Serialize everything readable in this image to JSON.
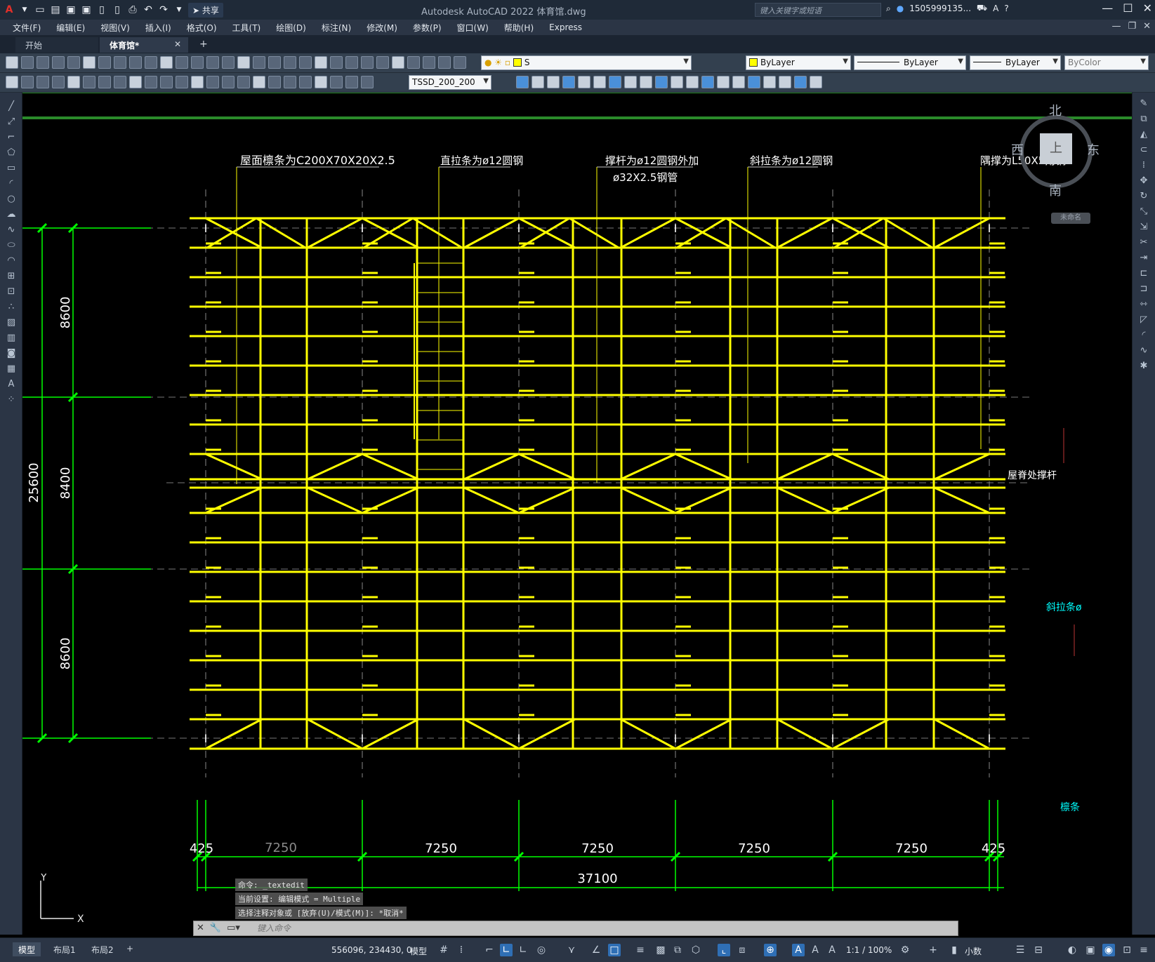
{
  "title_bar": {
    "share_label": "共享",
    "app_title": "Autodesk AutoCAD 2022    体育馆.dwg",
    "search_placeholder": "键入关键字或短语",
    "user_name": "1505999135..."
  },
  "menu": [
    "文件(F)",
    "编辑(E)",
    "视图(V)",
    "插入(I)",
    "格式(O)",
    "工具(T)",
    "绘图(D)",
    "标注(N)",
    "修改(M)",
    "参数(P)",
    "窗口(W)",
    "帮助(H)",
    "Express"
  ],
  "tabs": {
    "start": "开始",
    "document": "体育馆*"
  },
  "toolbar": {
    "layer_name": "S",
    "color": "ByLayer",
    "linetype": "ByLayer",
    "lineweight": "ByLayer",
    "plotstyle": "ByColor",
    "dimstyle": "TSSD_200_200"
  },
  "viewcube": {
    "north": "北",
    "south": "南",
    "east": "东",
    "west": "西",
    "top": "上",
    "ucs_name": "未命名"
  },
  "drawing": {
    "annotations": {
      "purlin": "屋面檩条为C200X70X20X2.5",
      "straight_tie": "直拉条为ø12圆钢",
      "strut_line1": "撑杆为ø12圆钢外加",
      "strut_line2": "ø32X2.5钢管",
      "diagonal_tie": "斜拉条为ø12圆钢",
      "brace": "隅撑为L50X5角钢",
      "ridge_strut": "屋脊处撑杆",
      "side_diag": "斜拉条ø",
      "side_purlin": "檩条"
    },
    "vertical_dims": [
      "8600",
      "8400",
      "8600"
    ],
    "vertical_total": "25600",
    "horizontal_dims": [
      "425",
      "7250",
      "7250",
      "7250",
      "7250",
      "425"
    ],
    "horizontal_ghost": "7250",
    "horizontal_total": "37100",
    "colors": {
      "purlin": "#ffff00",
      "dimension": "#00ff00",
      "axis": "#ffffff",
      "cyan_text": "#00ffff"
    }
  },
  "command": {
    "history": [
      "命令: _textedit",
      "当前设置: 编辑模式 = Multiple",
      "选择注释对象或 [放弃(U)/模式(M)]: *取消*"
    ],
    "placeholder": "键入命令"
  },
  "status": {
    "layout_tabs": [
      "模型",
      "布局1",
      "布局2"
    ],
    "coordinates": "556096, 234430, 0",
    "space": "模型",
    "scale": "1:1 / 100%",
    "units": "小数"
  },
  "ucs": {
    "x": "X",
    "y": "Y"
  }
}
